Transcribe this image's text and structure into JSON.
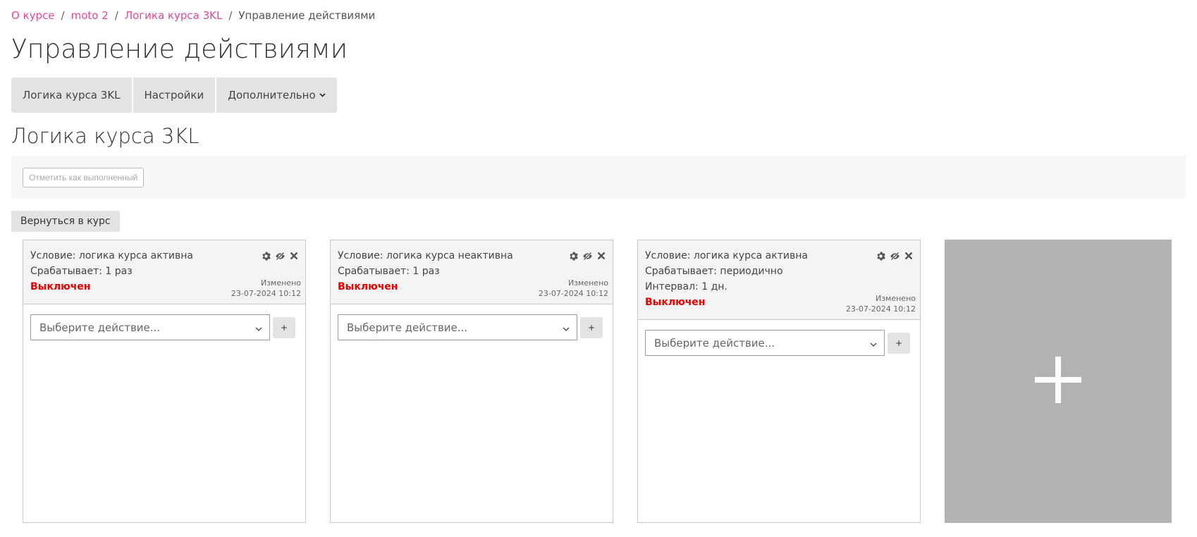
{
  "breadcrumb": {
    "items": [
      "О курсе",
      "moto 2",
      "Логика курса 3KL"
    ],
    "separator": "/",
    "current": "Управление действиями"
  },
  "page_title": "Управление действиями",
  "tabs": [
    {
      "label": "Логика курса 3KL"
    },
    {
      "label": "Настройки"
    },
    {
      "label": "Дополнительно"
    }
  ],
  "section_title": "Логика курса 3KL",
  "mark_done_label": "Отметить как выполненный",
  "back_label": "Вернуться в курс",
  "cards": [
    {
      "condition": "Условие: логика курса активна",
      "trigger": "Срабатывает: 1 раз",
      "interval": "",
      "status": "Выключен",
      "modified_label": "Изменено",
      "modified_date": "23-07-2024 10:12",
      "select_placeholder": "Выберите действие...",
      "add_label": "+"
    },
    {
      "condition": "Условие: логика курса неактивна",
      "trigger": "Срабатывает: 1 раз",
      "interval": "",
      "status": "Выключен",
      "modified_label": "Изменено",
      "modified_date": "23-07-2024 10:12",
      "select_placeholder": "Выберите действие...",
      "add_label": "+"
    },
    {
      "condition": "Условие: логика курса активна",
      "trigger": "Срабатывает: периодично",
      "interval": "Интервал: 1 дн.",
      "status": "Выключен",
      "modified_label": "Изменено",
      "modified_date": "23-07-2024 10:12",
      "select_placeholder": "Выберите действие...",
      "add_label": "+"
    }
  ],
  "icons": {
    "settings": "gear-icon",
    "visibility": "eye-slash-icon",
    "delete": "close-icon",
    "dropdown": "chevron-down-icon",
    "add_card": "plus-icon"
  },
  "colors": {
    "link": "#e0489b",
    "status_off": "#e60000",
    "tab_bg": "#e3e3e3",
    "add_card_bg": "#b3b3b3"
  }
}
